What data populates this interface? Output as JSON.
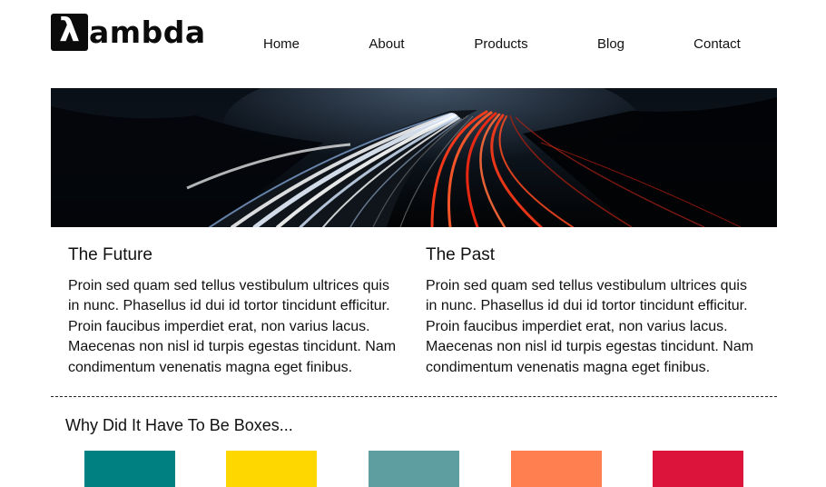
{
  "logo": {
    "lambda_glyph": "λ",
    "wordmark": "ambda"
  },
  "nav": {
    "items": [
      "Home",
      "About",
      "Products",
      "Blog",
      "Contact"
    ]
  },
  "hero": {
    "image": "highway-light-trails-at-night"
  },
  "columns": [
    {
      "heading": "The Future",
      "body": "Proin sed quam sed tellus vestibulum ultrices quis in nunc. Phasellus id dui id tortor tincidunt efficitur. Proin faucibus imperdiet erat, non varius lacus. Maecenas non nisl id turpis egestas tincidunt. Nam condimentum venenatis magna eget finibus."
    },
    {
      "heading": "The Past",
      "body": "Proin sed quam sed tellus vestibulum ultrices quis in nunc. Phasellus id dui id tortor tincidunt efficitur. Proin faucibus imperdiet erat, non varius lacus. Maecenas non nisl id turpis egestas tincidunt. Nam condimentum venenatis magna eget finibus."
    }
  ],
  "boxes_section": {
    "title": "Why Did It Have To Be Boxes...",
    "colors": [
      "#008080",
      "#FFD700",
      "#5F9EA0",
      "#FF7F50",
      "#DC143C"
    ]
  }
}
